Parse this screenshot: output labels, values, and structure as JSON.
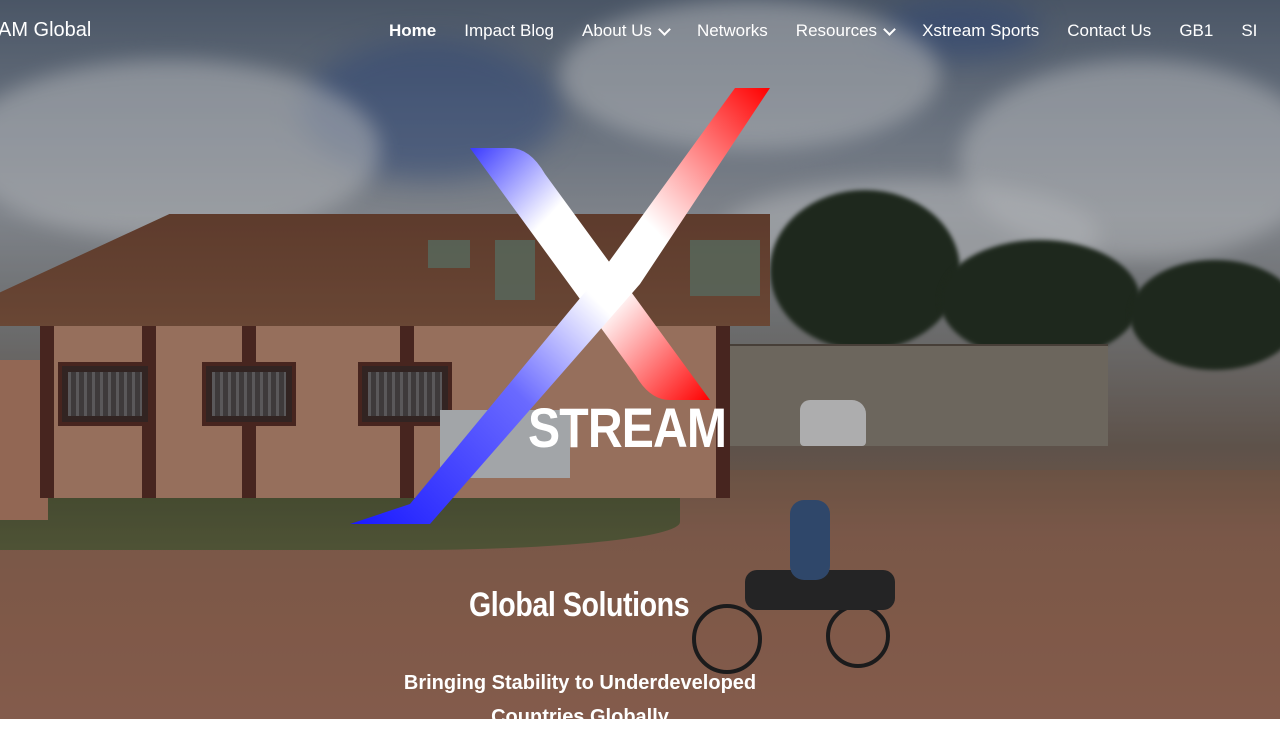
{
  "nav": {
    "brand": "AM Global",
    "items": [
      {
        "label": "Home",
        "active": true,
        "dropdown": false
      },
      {
        "label": "Impact Blog",
        "active": false,
        "dropdown": false
      },
      {
        "label": "About Us",
        "active": false,
        "dropdown": true
      },
      {
        "label": "Networks",
        "active": false,
        "dropdown": false
      },
      {
        "label": "Resources",
        "active": false,
        "dropdown": true
      },
      {
        "label": "Xstream Sports",
        "active": false,
        "dropdown": false
      },
      {
        "label": "Contact Us",
        "active": false,
        "dropdown": false
      },
      {
        "label": "GB1",
        "active": false,
        "dropdown": false
      },
      {
        "label": "SI",
        "active": false,
        "dropdown": false
      }
    ]
  },
  "logo": {
    "wordmark": "STREAM",
    "colors": {
      "red": "#ff0000",
      "blue": "#1a1aff",
      "white": "#ffffff"
    }
  },
  "hero": {
    "headline": "Global Solutions",
    "subline": "Bringing Stability to Underdeveloped Countries Globally"
  }
}
